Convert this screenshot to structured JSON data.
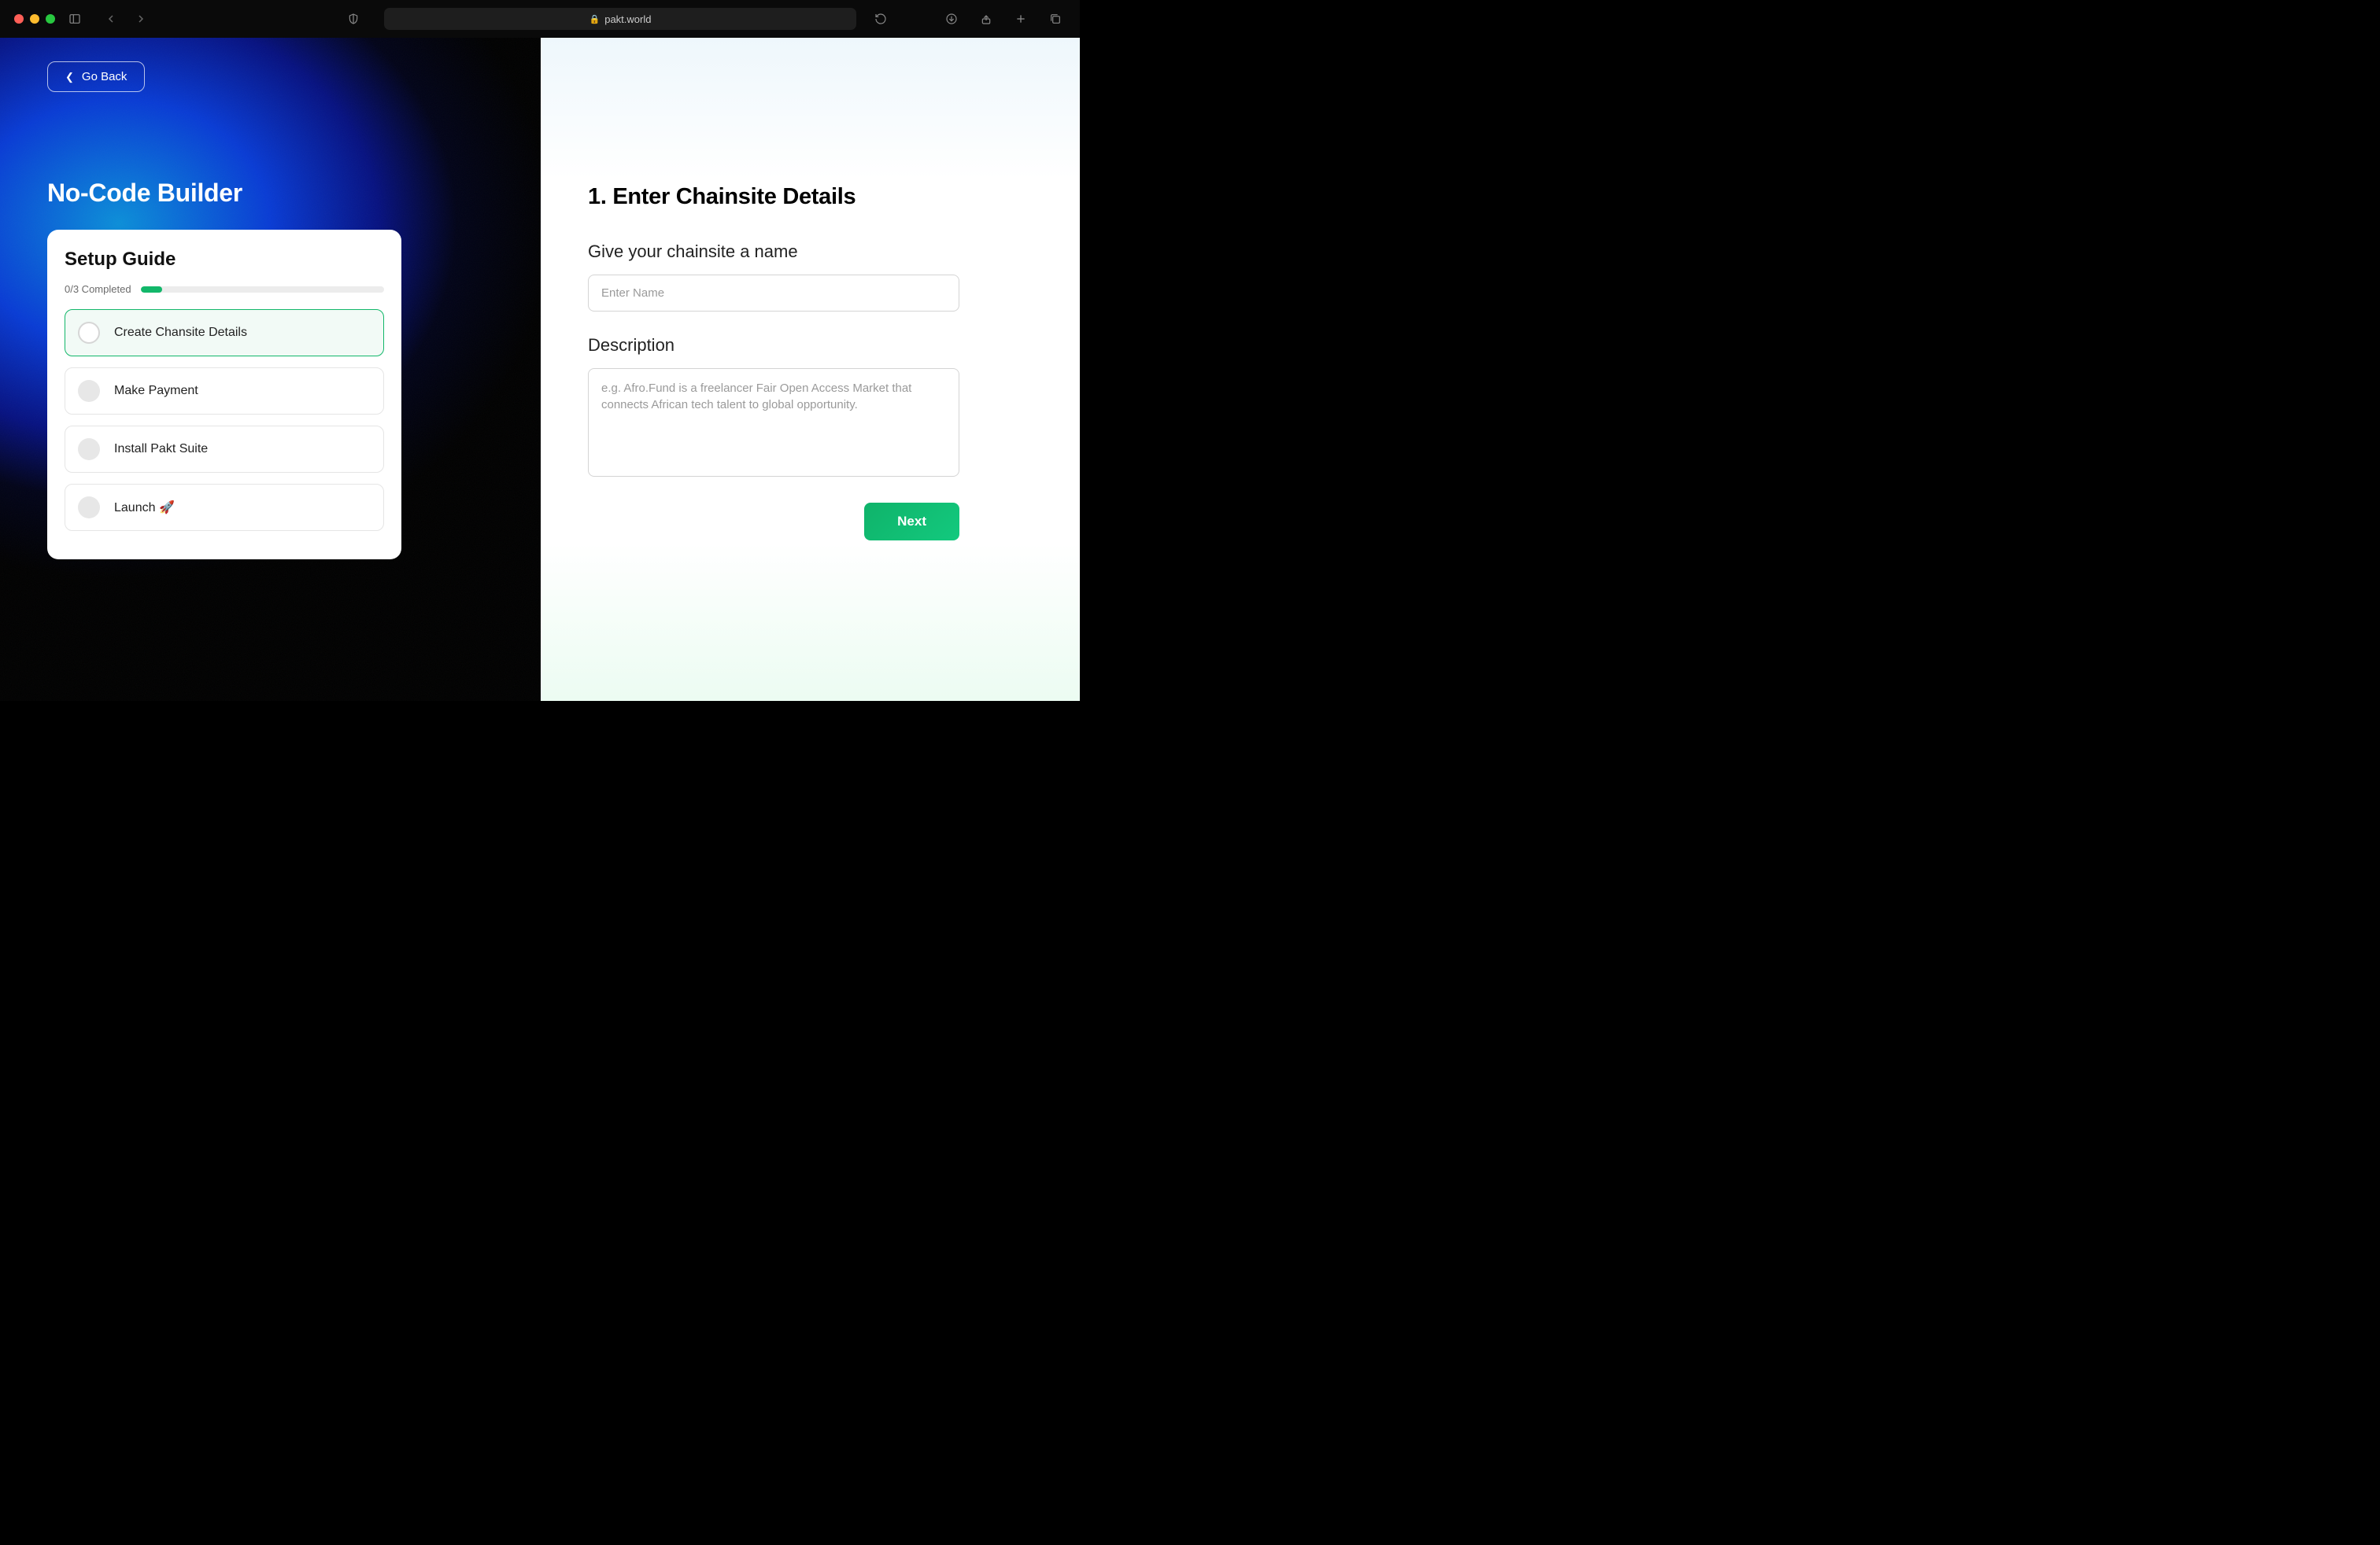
{
  "browser": {
    "url_display": "pakt.world"
  },
  "left": {
    "go_back": "Go Back",
    "title": "No-Code Builder",
    "setup": {
      "title": "Setup Guide",
      "progress_label": "0/3 Completed",
      "steps": [
        {
          "label": "Create Chansite Details",
          "active": true
        },
        {
          "label": "Make Payment",
          "active": false
        },
        {
          "label": "Install Pakt Suite",
          "active": false
        },
        {
          "label": "Launch 🚀",
          "active": false
        }
      ]
    }
  },
  "right": {
    "form_title": "1.  Enter Chainsite Details",
    "name_label": "Give your chainsite a name",
    "name_placeholder": "Enter Name",
    "name_value": "",
    "desc_label": "Description",
    "desc_placeholder": "e.g. Afro.Fund is a freelancer Fair Open Access Market that connects African tech talent to global opportunity.",
    "desc_value": "",
    "next_label": "Next"
  }
}
